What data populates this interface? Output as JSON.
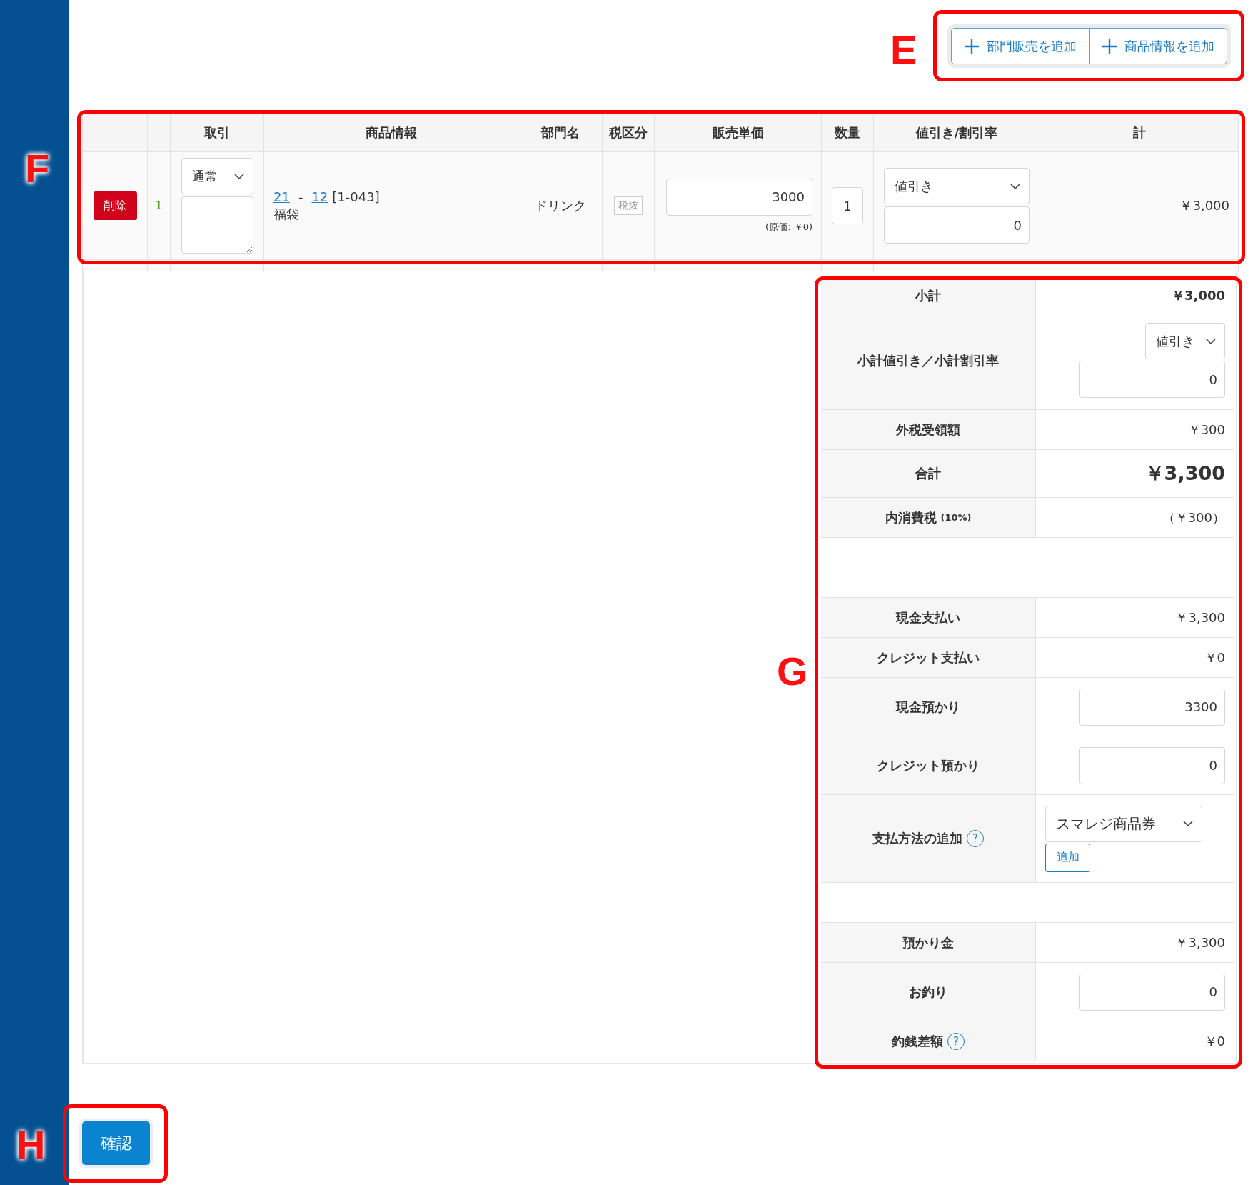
{
  "toolbar": {
    "callout": "E",
    "buttons": [
      {
        "label": "部門販売を追加"
      },
      {
        "label": "商品情報を追加"
      }
    ]
  },
  "line_items": {
    "callout": "F",
    "columns": [
      {
        "label": "取引"
      },
      {
        "label": "商品情報"
      },
      {
        "label": "部門名"
      },
      {
        "label": "税区分"
      },
      {
        "label": "販売単価"
      },
      {
        "label": "数量"
      },
      {
        "label": "値引き/割引率"
      },
      {
        "label": "計"
      }
    ],
    "rows": [
      {
        "delete_button": "削除",
        "number": "1",
        "transaction_type": "通常",
        "product_link_1": "21",
        "separator": "-",
        "product_link_2": "12",
        "product_code": "[1-043]",
        "product_name": "福袋",
        "department": "ドリンク",
        "tax_type": "税抜",
        "unit_price": "3000",
        "cost_note": "(原価: ￥0)",
        "quantity": "1",
        "discount_type": "値引き",
        "discount_value": "0",
        "total": "￥3,000"
      }
    ]
  },
  "summary": {
    "callout": "G",
    "rows": [
      {
        "kind": "subtotal",
        "label": "小計",
        "value": "￥3,000"
      },
      {
        "kind": "discount",
        "label": "小計値引き／小計割引率",
        "select": "値引き",
        "input": "0"
      },
      {
        "kind": "amount",
        "label": "外税受領額",
        "value": "￥300"
      },
      {
        "kind": "total",
        "label": "合計",
        "value": "￥3,300"
      },
      {
        "kind": "amount",
        "label": "内消費税",
        "note": "(10%)",
        "value": "（￥300）"
      },
      {
        "kind": "blank"
      },
      {
        "kind": "amount",
        "label": "現金支払い",
        "value": "￥3,300"
      },
      {
        "kind": "amount",
        "label": "クレジット支払い",
        "value": "￥0"
      },
      {
        "kind": "input",
        "label": "現金預かり",
        "input": "3300"
      },
      {
        "kind": "input",
        "label": "クレジット預かり",
        "input": "0"
      },
      {
        "kind": "payment",
        "label": "支払方法の追加",
        "help_icon": "?",
        "select": "スマレジ商品券",
        "button": "追加"
      },
      {
        "kind": "blank"
      },
      {
        "kind": "amount",
        "label": "預かり金",
        "value": "￥3,300"
      },
      {
        "kind": "input",
        "label": "お釣り",
        "input": "0"
      },
      {
        "kind": "amount",
        "label": "釣銭差額",
        "help_icon": "?",
        "value": "￥0"
      }
    ]
  },
  "footer": {
    "callout": "H",
    "confirm_button": "確認"
  }
}
